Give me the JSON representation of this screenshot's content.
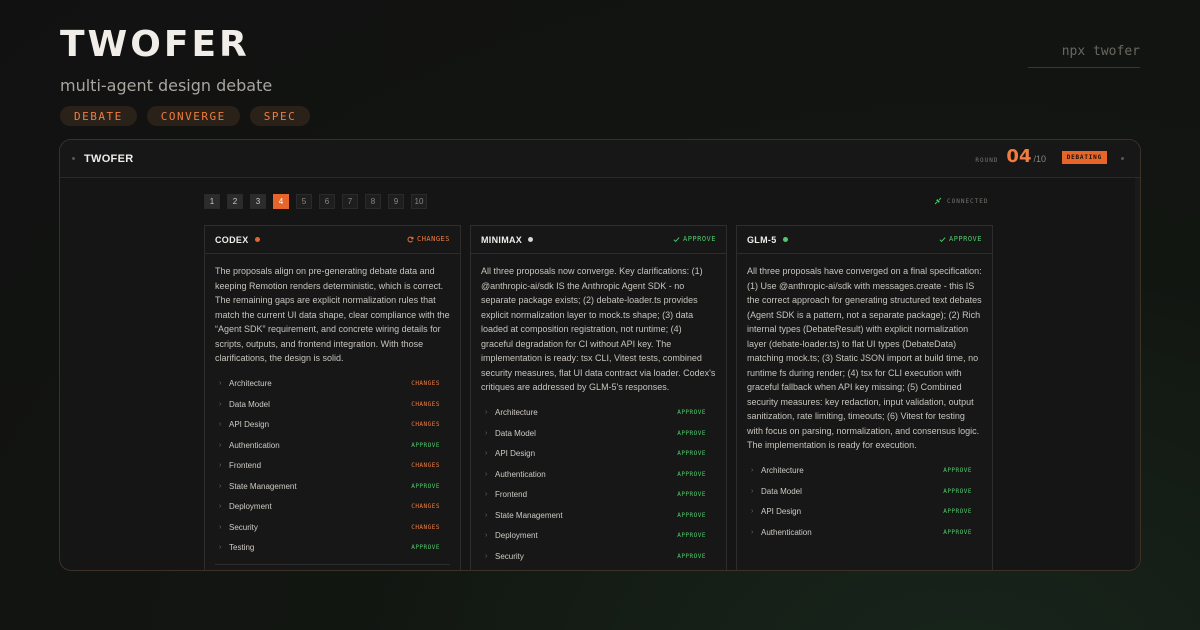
{
  "hero": {
    "title": "TWOFER",
    "subtitle": "multi-agent design debate",
    "pills": [
      "DEBATE",
      "CONVERGE",
      "SPEC"
    ],
    "command": "npx twofer"
  },
  "window": {
    "title": "TWOFER",
    "round_label": "ROUND",
    "round_current": "04",
    "round_total": "/10",
    "status_badge": "DEBATING",
    "connection_status": "CONNECTED"
  },
  "pager": {
    "pages": [
      "1",
      "2",
      "3",
      "4",
      "5",
      "6",
      "7",
      "8",
      "9",
      "10"
    ],
    "current": "4"
  },
  "colors": {
    "accent": "#e8652a",
    "changes": "#f07c3f",
    "approve": "#4ec96a",
    "neutral_dot": "#d8d4ce"
  },
  "cards": [
    {
      "agent": "CODEX",
      "dot_color": "#e8652a",
      "verdict": "CHANGES",
      "verdict_icon": "refresh-icon",
      "summary": "The proposals align on pre-generating debate data and keeping Remotion renders deterministic, which is correct. The remaining gaps are explicit normalization rules that match the current UI data shape, clear compliance with the “Agent SDK” requirement, and concrete wiring details for scripts, outputs, and frontend integration. With those clarifications, the design is solid.",
      "topics": [
        {
          "name": "Architecture",
          "status": "CHANGES"
        },
        {
          "name": "Data Model",
          "status": "CHANGES"
        },
        {
          "name": "API Design",
          "status": "CHANGES"
        },
        {
          "name": "Authentication",
          "status": "APPROVE"
        },
        {
          "name": "Frontend",
          "status": "CHANGES"
        },
        {
          "name": "State Management",
          "status": "APPROVE"
        },
        {
          "name": "Deployment",
          "status": "CHANGES"
        },
        {
          "name": "Security",
          "status": "CHANGES"
        },
        {
          "name": "Testing",
          "status": "APPROVE"
        }
      ]
    },
    {
      "agent": "MINIMAX",
      "dot_color": "#d8d4ce",
      "verdict": "APPROVE",
      "verdict_icon": "check-icon",
      "summary": "All three proposals now converge. Key clarifications: (1) @anthropic-ai/sdk IS the Anthropic Agent SDK - no separate package exists; (2) debate-loader.ts provides explicit normalization layer to mock.ts shape; (3) data loaded at composition registration, not runtime; (4) graceful degradation for CI without API key. The implementation is ready: tsx CLI, Vitest tests, combined security measures, flat UI data contract via loader. Codex's critiques are addressed by GLM-5's responses.",
      "topics": [
        {
          "name": "Architecture",
          "status": "APPROVE"
        },
        {
          "name": "Data Model",
          "status": "APPROVE"
        },
        {
          "name": "API Design",
          "status": "APPROVE"
        },
        {
          "name": "Authentication",
          "status": "APPROVE"
        },
        {
          "name": "Frontend",
          "status": "APPROVE"
        },
        {
          "name": "State Management",
          "status": "APPROVE"
        },
        {
          "name": "Deployment",
          "status": "APPROVE"
        },
        {
          "name": "Security",
          "status": "APPROVE"
        }
      ]
    },
    {
      "agent": "GLM-5",
      "dot_color": "#4ec96a",
      "verdict": "APPROVE",
      "verdict_icon": "check-icon",
      "summary": "All three proposals have converged on a final specification: (1) Use @anthropic-ai/sdk with messages.create - this IS the correct approach for generating structured text debates (Agent SDK is a pattern, not a separate package); (2) Rich internal types (DebateResult) with explicit normalization layer (debate-loader.ts) to flat UI types (DebateData) matching mock.ts; (3) Static JSON import at build time, no runtime fs during render; (4) tsx for CLI execution with graceful fallback when API key missing; (5) Combined security measures: key redaction, input validation, output sanitization, rate limiting, timeouts; (6) Vitest for testing with focus on parsing, normalization, and consensus logic. The implementation is ready for execution.",
      "topics": [
        {
          "name": "Architecture",
          "status": "APPROVE"
        },
        {
          "name": "Data Model",
          "status": "APPROVE"
        },
        {
          "name": "API Design",
          "status": "APPROVE"
        },
        {
          "name": "Authentication",
          "status": "APPROVE"
        }
      ]
    }
  ]
}
